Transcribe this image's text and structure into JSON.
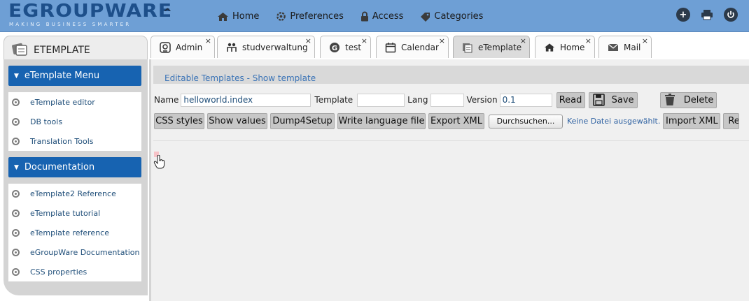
{
  "brand": {
    "name": "EGROUPWARE",
    "tagline": "MAKING BUSINESS SMARTER",
    "colors": {
      "topbar": "#6e9fd5",
      "sidebox": "#1763b1",
      "link": "#1f4e79"
    }
  },
  "topnav": {
    "items": [
      {
        "label": "Home",
        "icon": "house-icon"
      },
      {
        "label": "Preferences",
        "icon": "gear-icon"
      },
      {
        "label": "Access",
        "icon": "lock-icon"
      },
      {
        "label": "Categories",
        "icon": "tag-icon"
      }
    ],
    "actions": [
      "add-icon",
      "print-icon",
      "power-icon"
    ]
  },
  "app_title": "ETEMPLATE",
  "tabs": [
    {
      "label": "Admin",
      "icon": "admin-icon",
      "active": false
    },
    {
      "label": "studverwaltung",
      "icon": "people-icon",
      "active": false
    },
    {
      "label": "test",
      "icon": "g-icon",
      "active": false
    },
    {
      "label": "Calendar",
      "icon": "calendar-icon",
      "active": false
    },
    {
      "label": "eTemplate",
      "icon": "etemplate-icon",
      "active": true
    },
    {
      "label": "Home",
      "icon": "house-icon",
      "active": false
    },
    {
      "label": "Mail",
      "icon": "mail-icon",
      "active": false
    }
  ],
  "tab_close": "×",
  "sidebar": {
    "menu": {
      "title": "eTemplate Menu",
      "items": [
        "eTemplate editor",
        "DB tools",
        "Translation Tools"
      ]
    },
    "docs": {
      "title": "Documentation",
      "items": [
        "eTemplate2 Reference",
        "eTemplate tutorial",
        "eTemplate reference",
        "eGroupWare Documentation",
        "CSS properties"
      ]
    }
  },
  "main": {
    "heading": "Editable Templates - Show template",
    "form": {
      "name_label": "Name",
      "name_value": "helloworld.index",
      "template_label": "Template",
      "template_value": "",
      "lang_label": "Lang",
      "lang_value": "",
      "version_label": "Version",
      "version_value": "0.1",
      "read_label": "Read",
      "save_label": "Save",
      "delete_label": "Delete"
    },
    "buttons": {
      "css": "CSS styles",
      "show_values": "Show values",
      "dump": "Dump4Setup",
      "write_lang": "Write language file",
      "export_xml": "Export XML",
      "browse": "Durchsuchen...",
      "no_file": "Keine Datei ausgewählt.",
      "import_xml": "Import XML",
      "cut_off": "Re"
    }
  }
}
